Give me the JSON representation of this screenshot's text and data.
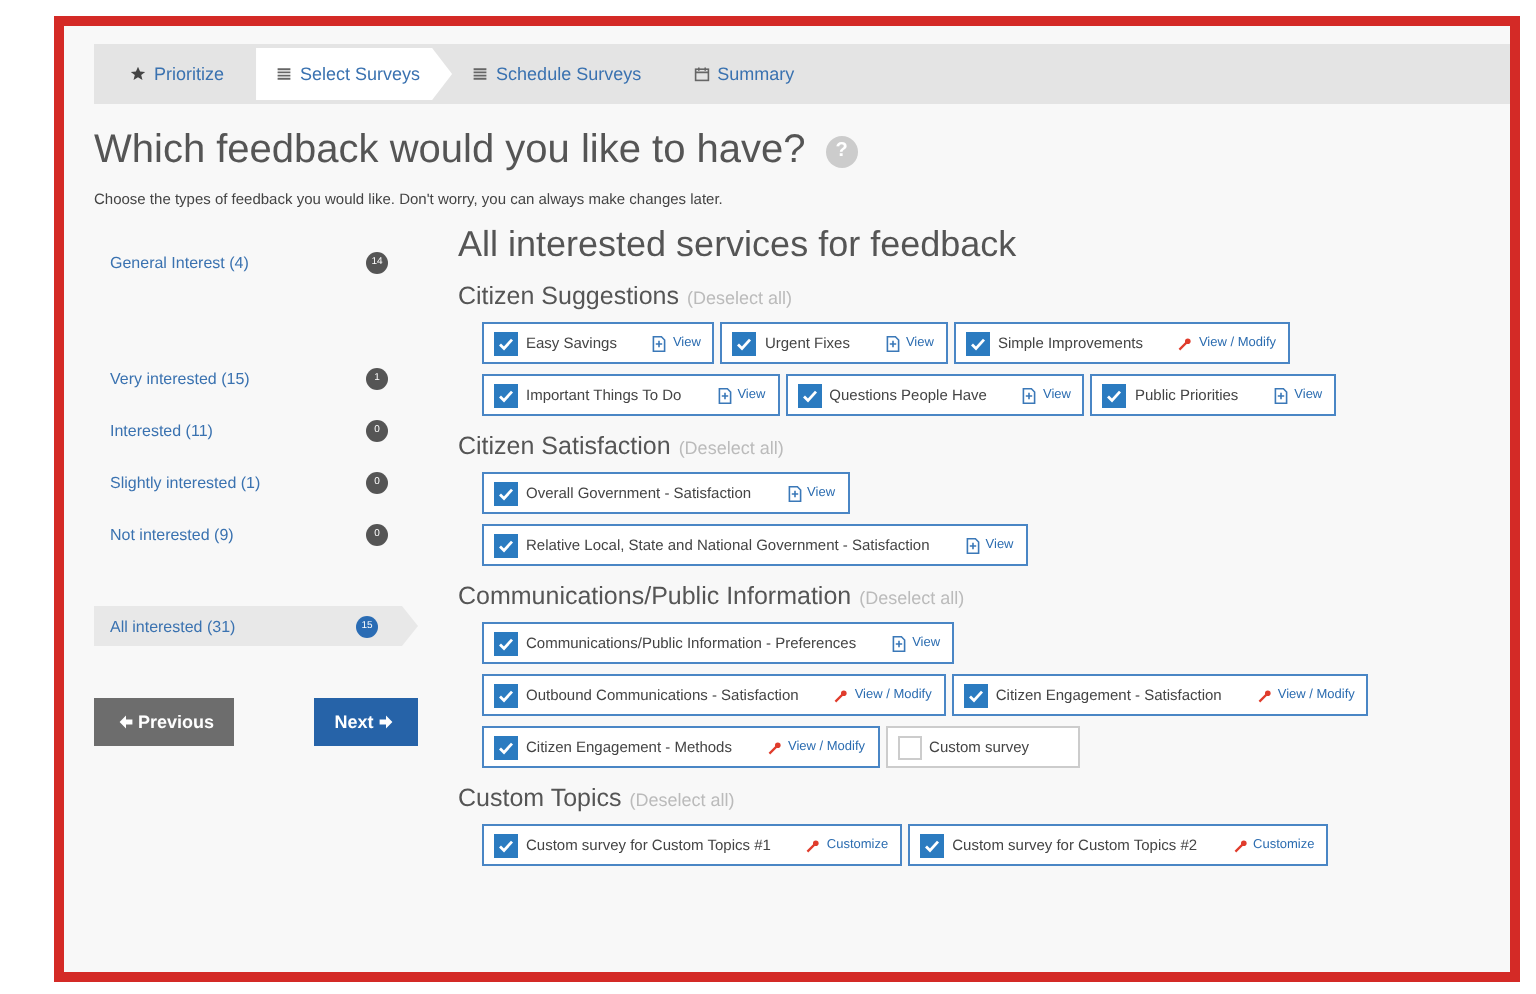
{
  "steps": [
    {
      "label": "Prioritize",
      "kind": "rank",
      "selected": false
    },
    {
      "label": "Select Surveys",
      "kind": "select",
      "selected": true
    },
    {
      "label": "Schedule Surveys",
      "kind": "schedule",
      "selected": false
    },
    {
      "label": "Summary",
      "kind": "summary",
      "selected": false
    }
  ],
  "title": "Which feedback would you like to have?",
  "help": "?",
  "subtitle": "Choose the types of feedback you would like. Don't worry, you can always make changes later.",
  "sidebar": {
    "groups": [
      [
        {
          "label": "General Interest (4)",
          "badge": "14",
          "selected": false
        }
      ],
      [
        {
          "label": "Very interested (15)",
          "badge": "1",
          "selected": false
        },
        {
          "label": "Interested (11)",
          "badge": "0",
          "selected": false
        },
        {
          "label": "Slightly interested (1)",
          "badge": "0",
          "selected": false
        },
        {
          "label": "Not interested (9)",
          "badge": "0",
          "selected": false
        }
      ],
      [
        {
          "label": "All interested (31)",
          "badge": "15",
          "selected": true
        }
      ]
    ],
    "buttons": [
      {
        "label": "Previous",
        "kind": "previous"
      },
      {
        "label": "Next",
        "kind": "next"
      }
    ]
  },
  "heading": "All interested services for feedback",
  "sections": [
    {
      "title": "Citizen Suggestions",
      "deselect": "(Deselect all)",
      "rows": [
        [
          {
            "label": "Easy Savings",
            "checked": true,
            "action": "View",
            "kind": "view"
          },
          {
            "label": "Urgent Fixes",
            "checked": true,
            "action": "View",
            "kind": "view"
          },
          {
            "label": "Simple Improvements",
            "checked": true,
            "action": "View / Modify",
            "kind": "modify"
          }
        ],
        [
          {
            "label": "Important Things To Do",
            "checked": true,
            "action": "View",
            "kind": "view"
          },
          {
            "label": "Questions People Have",
            "checked": true,
            "action": "View",
            "kind": "view"
          },
          {
            "label": "Public Priorities",
            "checked": true,
            "action": "View",
            "kind": "view"
          }
        ]
      ]
    },
    {
      "title": "Citizen Satisfaction",
      "deselect": "(Deselect all)",
      "rows": [
        [
          {
            "label": "Overall Government - Satisfaction",
            "checked": true,
            "action": "View",
            "kind": "view"
          }
        ],
        [
          {
            "label": "Relative Local, State and National Government - Satisfaction",
            "checked": true,
            "action": "View",
            "kind": "view"
          }
        ]
      ]
    },
    {
      "title": "Communications/Public Information",
      "deselect": "(Deselect all)",
      "rows": [
        [
          {
            "label": "Communications/Public Information - Preferences",
            "checked": true,
            "action": "View",
            "kind": "view"
          }
        ],
        [
          {
            "label": "Outbound Communications - Satisfaction",
            "checked": true,
            "action": "View / Modify",
            "kind": "modify"
          },
          {
            "label": "Citizen Engagement - Satisfaction",
            "checked": true,
            "action": "View / Modify",
            "kind": "modify"
          }
        ],
        [
          {
            "label": "Citizen Engagement - Methods",
            "checked": true,
            "action": "View / Modify",
            "kind": "modify"
          },
          {
            "label": "Custom survey",
            "checked": false,
            "kind": "custom"
          }
        ]
      ]
    },
    {
      "title": "Custom Topics",
      "deselect": "(Deselect all)",
      "rows": [
        [
          {
            "label": "Custom survey for Custom Topics #1",
            "checked": true,
            "action": "Customize",
            "kind": "modify"
          },
          {
            "label": "Custom survey for Custom Topics #2",
            "checked": true,
            "action": "Customize",
            "kind": "modify"
          }
        ]
      ]
    }
  ]
}
